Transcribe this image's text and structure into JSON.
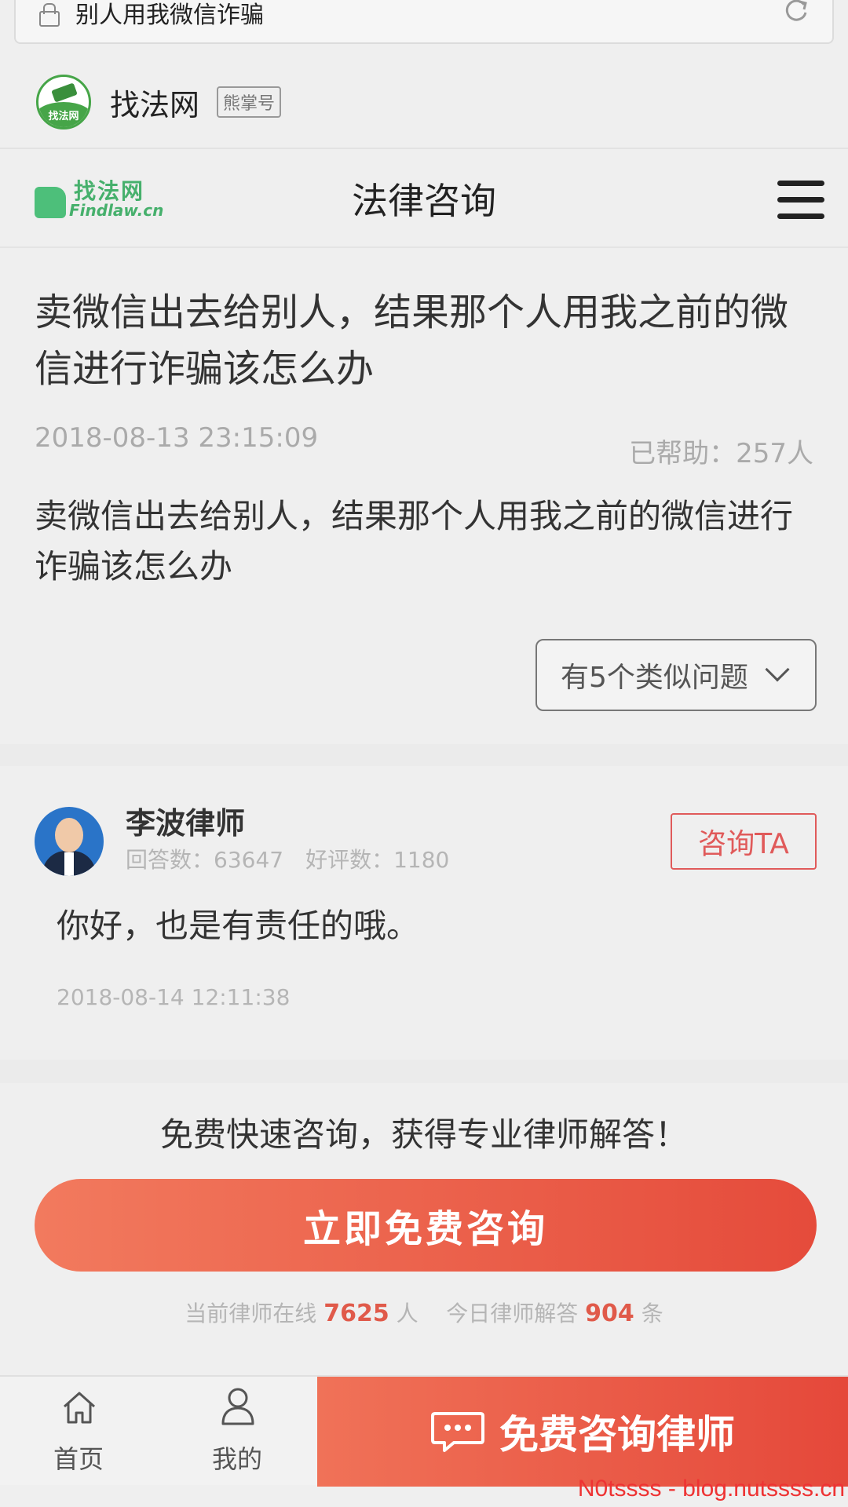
{
  "browser": {
    "search_text": "别人用我微信诈骗"
  },
  "account": {
    "name": "找法网",
    "tag": "熊掌号",
    "logo_text": "找法网"
  },
  "header": {
    "logo_cn": "找法网",
    "logo_en": "Findlaw.cn",
    "title": "法律咨询"
  },
  "question": {
    "title": "卖微信出去给别人，结果那个人用我之前的微信进行诈骗该怎么办",
    "time": "2018-08-13 23:15:09",
    "helped": "已帮助：257人",
    "body": "卖微信出去给别人，结果那个人用我之前的微信进行诈骗该怎么办",
    "similar_label": "有5个类似问题"
  },
  "answer": {
    "lawyer_name": "李波律师",
    "answers_label": "回答数：63647",
    "ratings_label": "好评数：1180",
    "consult_label": "咨询TA",
    "text": "你好，也是有责任的哦。",
    "time": "2018-08-14 12:11:38"
  },
  "promo": {
    "title": "免费快速咨询，获得专业律师解答！",
    "button": "立即免费咨询",
    "online_prefix": "当前律师在线",
    "online_count": "7625",
    "online_suffix": "人",
    "answered_prefix": "今日律师解答",
    "answered_count": "904",
    "answered_suffix": "条"
  },
  "bottom_nav": {
    "home": "首页",
    "mine": "我的",
    "cta": "免费咨询律师"
  },
  "watermark": "N0tssss - blog.nutssss.cn",
  "colors": {
    "accent": "#e5483a",
    "brand_green": "#46b06c",
    "muted_text": "#b5b5b5"
  }
}
